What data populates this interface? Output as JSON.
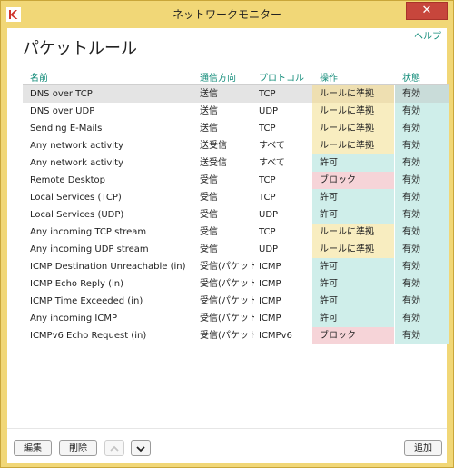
{
  "window": {
    "title": "ネットワークモニター",
    "close_glyph": "✕"
  },
  "page": {
    "help_link": "ヘルプ",
    "heading": "パケットルール"
  },
  "table": {
    "headers": {
      "name": "名前",
      "direction": "通信方向",
      "protocol": "プロトコル",
      "action": "操作",
      "state": "状態"
    },
    "rows": [
      {
        "name": "DNS over TCP",
        "direction": "送信",
        "protocol": "TCP",
        "action": "ルールに準拠",
        "action_type": "rule",
        "state": "有効",
        "selected": true
      },
      {
        "name": "DNS over UDP",
        "direction": "送信",
        "protocol": "UDP",
        "action": "ルールに準拠",
        "action_type": "rule",
        "state": "有効",
        "selected": false
      },
      {
        "name": "Sending E-Mails",
        "direction": "送信",
        "protocol": "TCP",
        "action": "ルールに準拠",
        "action_type": "rule",
        "state": "有効",
        "selected": false
      },
      {
        "name": "Any network activity",
        "direction": "送受信",
        "protocol": "すべて",
        "action": "ルールに準拠",
        "action_type": "rule",
        "state": "有効",
        "selected": false
      },
      {
        "name": "Any network activity",
        "direction": "送受信",
        "protocol": "すべて",
        "action": "許可",
        "action_type": "allow",
        "state": "有効",
        "selected": false
      },
      {
        "name": "Remote Desktop",
        "direction": "受信",
        "protocol": "TCP",
        "action": "ブロック",
        "action_type": "block",
        "state": "有効",
        "selected": false
      },
      {
        "name": "Local Services (TCP)",
        "direction": "受信",
        "protocol": "TCP",
        "action": "許可",
        "action_type": "allow",
        "state": "有効",
        "selected": false
      },
      {
        "name": "Local Services (UDP)",
        "direction": "受信",
        "protocol": "UDP",
        "action": "許可",
        "action_type": "allow",
        "state": "有効",
        "selected": false
      },
      {
        "name": "Any incoming TCP stream",
        "direction": "受信",
        "protocol": "TCP",
        "action": "ルールに準拠",
        "action_type": "rule",
        "state": "有効",
        "selected": false
      },
      {
        "name": "Any incoming UDP stream",
        "direction": "受信",
        "protocol": "UDP",
        "action": "ルールに準拠",
        "action_type": "rule",
        "state": "有効",
        "selected": false
      },
      {
        "name": "ICMP Destination Unreachable (in)",
        "direction": "受信(パケット)",
        "protocol": "ICMP",
        "action": "許可",
        "action_type": "allow",
        "state": "有効",
        "selected": false
      },
      {
        "name": "ICMP Echo Reply (in)",
        "direction": "受信(パケット)",
        "protocol": "ICMP",
        "action": "許可",
        "action_type": "allow",
        "state": "有効",
        "selected": false
      },
      {
        "name": "ICMP Time Exceeded (in)",
        "direction": "受信(パケット)",
        "protocol": "ICMP",
        "action": "許可",
        "action_type": "allow",
        "state": "有効",
        "selected": false
      },
      {
        "name": "Any incoming ICMP",
        "direction": "受信(パケット)",
        "protocol": "ICMP",
        "action": "許可",
        "action_type": "allow",
        "state": "有効",
        "selected": false
      },
      {
        "name": "ICMPv6 Echo Request (in)",
        "direction": "受信(パケット)",
        "protocol": "ICMPv6",
        "action": "ブロック",
        "action_type": "block",
        "state": "有効",
        "selected": false
      }
    ]
  },
  "footer": {
    "edit_label": "編集",
    "delete_label": "削除",
    "move_up_icon": "chevron-up-icon",
    "move_down_icon": "chevron-down-icon",
    "add_label": "追加"
  },
  "colors": {
    "accent": "#138c7a",
    "frame": "#f1d777",
    "close": "#c7463c",
    "rule_bg": "#f8edc0",
    "allow_bg": "#cfeeea",
    "block_bg": "#f6d4d8"
  }
}
